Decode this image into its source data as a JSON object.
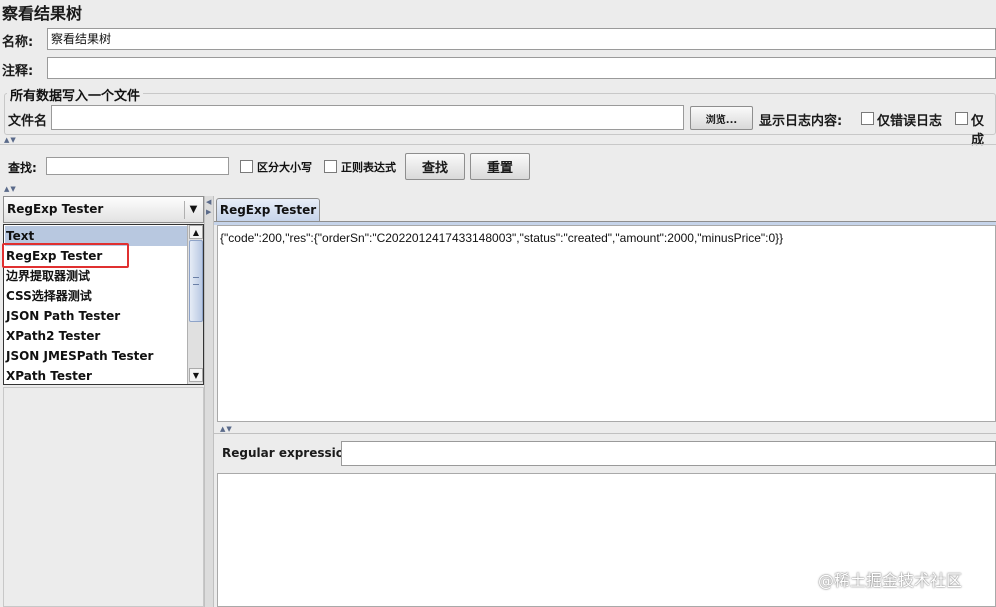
{
  "window": {
    "title": "察看结果树"
  },
  "form": {
    "name_label": "名称:",
    "name_value": "察看结果树",
    "comment_label": "注释:",
    "comment_value": ""
  },
  "file_group": {
    "title": "所有数据写入一个文件",
    "filename_label": "文件名",
    "filename_value": "",
    "browse_label": "浏览...",
    "log_label": "显示日志内容:",
    "errors_only_label": "仅错误日志",
    "success_only_label": "仅成"
  },
  "search": {
    "label": "查找:",
    "value": "",
    "case_label": "区分大小写",
    "regex_label": "正则表达式",
    "find_button": "查找",
    "reset_button": "重置"
  },
  "renderer": {
    "selected": "RegExp Tester",
    "items": [
      "Text",
      "RegExp Tester",
      "边界提取器测试",
      "CSS选择器测试",
      "JSON Path Tester",
      "XPath2 Tester",
      "JSON JMESPath Tester",
      "XPath Tester"
    ],
    "highlighted_index": 0
  },
  "result": {
    "tab_label": "RegExp Tester",
    "response_text": "{\"code\":200,\"res\":{\"orderSn\":\"C2022012417433148003\",\"status\":\"created\",\"amount\":2000,\"minusPrice\":0}}",
    "regex_label": "Regular expression:",
    "regex_value": ""
  },
  "watermark": "@稀土掘金技术社区"
}
